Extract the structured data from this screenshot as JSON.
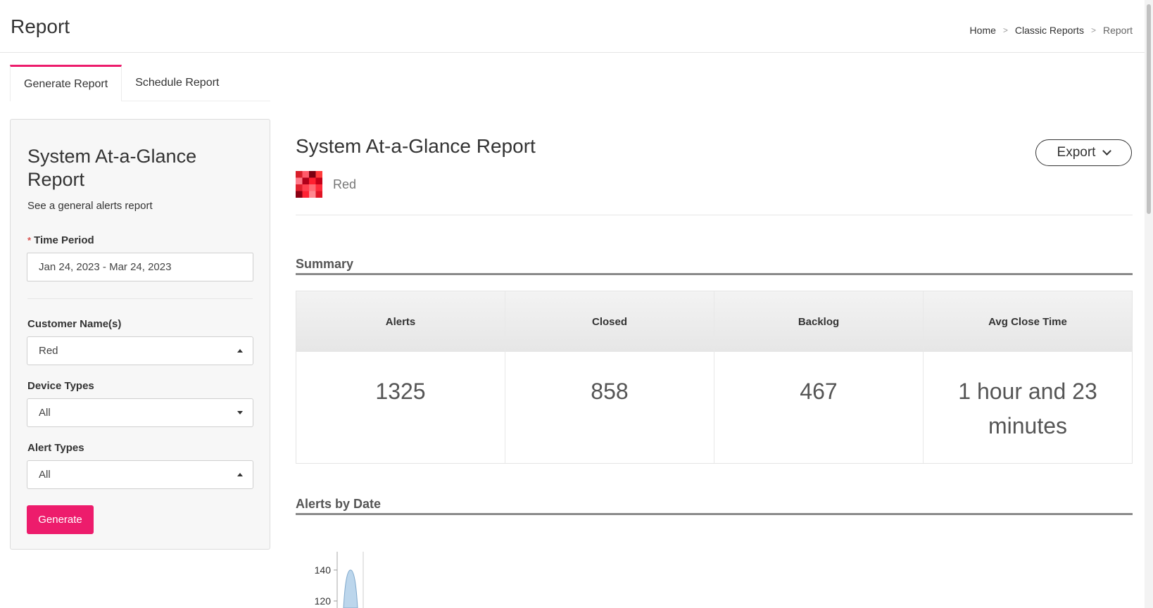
{
  "header": {
    "title": "Report",
    "breadcrumb": [
      "Home",
      "Classic Reports",
      "Report"
    ],
    "breadcrumb_sep": ">"
  },
  "tabs": [
    {
      "label": "Generate Report",
      "active": true
    },
    {
      "label": "Schedule Report",
      "active": false
    }
  ],
  "form": {
    "title": "System At-a-Glance Report",
    "description": "See a general alerts report",
    "time_period": {
      "label": "Time Period",
      "required_mark": "*",
      "value": "Jan 24, 2023 - Mar 24, 2023"
    },
    "customer": {
      "label": "Customer Name(s)",
      "value": "Red"
    },
    "device_types": {
      "label": "Device Types",
      "value": "All"
    },
    "alert_types": {
      "label": "Alert Types",
      "value": "All"
    },
    "generate_label": "Generate"
  },
  "report": {
    "title": "System At-a-Glance Report",
    "customer": "Red",
    "export_label": "Export",
    "summary_title": "Summary",
    "summary": [
      {
        "label": "Alerts",
        "value": "1325"
      },
      {
        "label": "Closed",
        "value": "858"
      },
      {
        "label": "Backlog",
        "value": "467"
      },
      {
        "label": "Avg Close Time",
        "value": "1 hour and 23 minutes"
      }
    ],
    "alerts_by_date_title": "Alerts by Date"
  },
  "colors": {
    "accent": "#ed1c6c",
    "chart_fill": "#bcd6ec",
    "chart_stroke": "#7fa8cc"
  },
  "chart_data": {
    "type": "area",
    "yticks": [
      140,
      120
    ],
    "series": [
      {
        "peak": 140
      }
    ]
  }
}
